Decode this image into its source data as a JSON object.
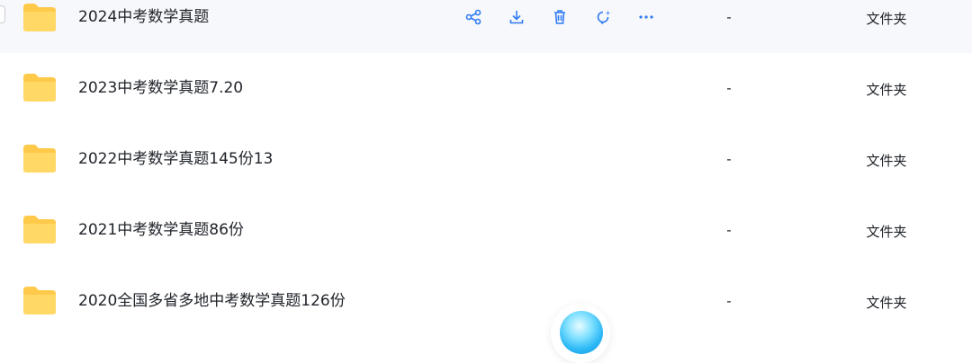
{
  "files": [
    {
      "name": "2024中考数学真题",
      "size": "-",
      "type": "文件夹"
    },
    {
      "name": "2023中考数学真题7.20",
      "size": "-",
      "type": "文件夹"
    },
    {
      "name": "2022中考数学真题145份13",
      "size": "-",
      "type": "文件夹"
    },
    {
      "name": "2021中考数学真题86份",
      "size": "-",
      "type": "文件夹"
    },
    {
      "name": "2020全国多省多地中考数学真题126份",
      "size": "-",
      "type": "文件夹"
    }
  ],
  "hover_actions": [
    "share-icon",
    "download-icon",
    "delete-icon",
    "refresh-icon",
    "more-icon"
  ],
  "colors": {
    "accent": "#2f7bf5",
    "folder": "#ffc94a",
    "hover_bg": "#f7f8fb"
  }
}
